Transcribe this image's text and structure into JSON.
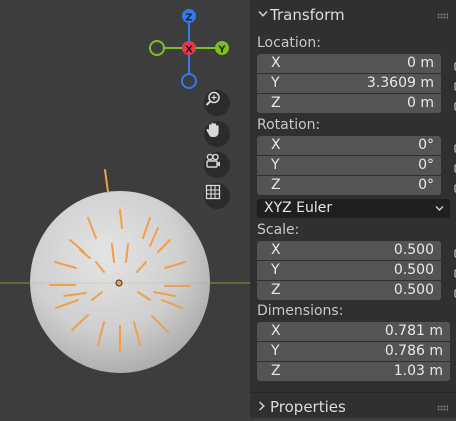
{
  "gizmo": {
    "z_label": "Z",
    "x_label": "X",
    "y_label": "Y",
    "colors": {
      "x": "#e13b4e",
      "y": "#7fbf26",
      "z": "#2f7de6"
    }
  },
  "viewport_tools": [
    {
      "name": "zoom-icon"
    },
    {
      "name": "hand-pan-icon"
    },
    {
      "name": "camera-view-icon"
    },
    {
      "name": "grid-ortho-icon"
    }
  ],
  "panel": {
    "transform_title": "Transform",
    "location": {
      "label": "Location:",
      "x": {
        "axis": "X",
        "value": "0 m"
      },
      "y": {
        "axis": "Y",
        "value": "3.3609 m"
      },
      "z": {
        "axis": "Z",
        "value": "0 m"
      }
    },
    "rotation": {
      "label": "Rotation:",
      "x": {
        "axis": "X",
        "value": "0°"
      },
      "y": {
        "axis": "Y",
        "value": "0°"
      },
      "z": {
        "axis": "Z",
        "value": "0°"
      },
      "mode": "XYZ Euler"
    },
    "scale": {
      "label": "Scale:",
      "x": {
        "axis": "X",
        "value": "0.500"
      },
      "y": {
        "axis": "Y",
        "value": "0.500"
      },
      "z": {
        "axis": "Z",
        "value": "0.500"
      }
    },
    "dimensions": {
      "label": "Dimensions:",
      "x": {
        "axis": "X",
        "value": "0.781 m"
      },
      "y": {
        "axis": "Y",
        "value": "0.786 m"
      },
      "z": {
        "axis": "Z",
        "value": "1.03 m"
      }
    },
    "properties_title": "Properties"
  },
  "colors": {
    "accent_orange": "#f0a04b",
    "field_bg": "#545454",
    "panel_bg": "#303030"
  }
}
